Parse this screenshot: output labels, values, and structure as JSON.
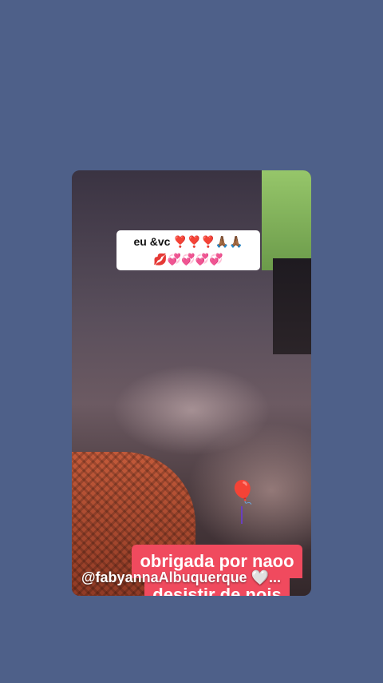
{
  "story": {
    "sticker_line1": "eu &vc ❣️❣️❣️🙏🏾🙏🏾",
    "sticker_line2": "💋💞💞💞💞",
    "caption_line1": "obrigada por naoo",
    "caption_line2": "desistir de nois",
    "balloons_emoji": "🎈",
    "username": "@fabyannaAlbuquerque 🤍..."
  },
  "colors": {
    "background": "#4e6089",
    "caption_bg": "#f04a5e",
    "sticker_bg": "#ffffff"
  }
}
